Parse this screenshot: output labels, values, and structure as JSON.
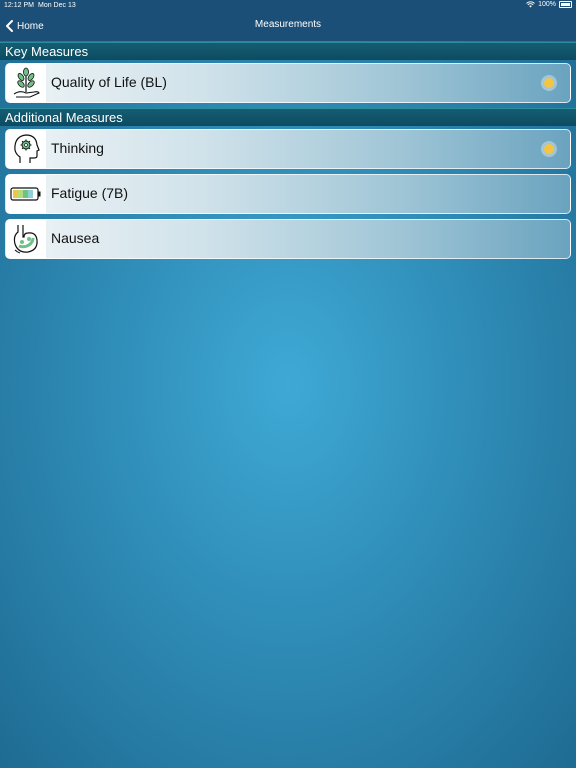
{
  "status": {
    "time": "12:12 PM",
    "date": "Mon Dec 13",
    "battery": "100%"
  },
  "nav": {
    "back_label": "Home",
    "title": "Measurements"
  },
  "sections": {
    "key": {
      "title": "Key Measures"
    },
    "additional": {
      "title": "Additional Measures"
    }
  },
  "rows": [
    {
      "label": "Quality of Life (BL)",
      "icon": "plant-hand-icon",
      "indicator": true
    },
    {
      "label": "Thinking",
      "icon": "head-gear-icon",
      "indicator": true
    },
    {
      "label": "Fatigue (7B)",
      "icon": "battery-icon",
      "indicator": false
    },
    {
      "label": "Nausea",
      "icon": "stomach-icon",
      "indicator": false
    }
  ],
  "colors": {
    "indicator": "#f4c542",
    "nav_bg": "#1c4f77",
    "header_bg": "#0d4b60"
  }
}
